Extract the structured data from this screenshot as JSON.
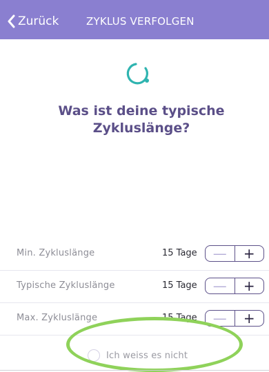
{
  "header": {
    "back_label": "Zurück",
    "title": "ZYKLUS VERFOLGEN",
    "background": "#8a7fd0"
  },
  "progress_icon": {
    "icon": "circular-spinner-icon",
    "color": "#2fb4b0"
  },
  "question": {
    "line1": "Was ist deine typische",
    "line2": "Zykluslänge?"
  },
  "settings": {
    "rows": [
      {
        "label": "Min. Zykluslänge",
        "value": "15 Tage",
        "minus": "—",
        "plus": "+"
      },
      {
        "label": "Typische Zykluslänge",
        "value": "15 Tage",
        "minus": "—",
        "plus": "+"
      },
      {
        "label": "Max. Zykluslänge",
        "value": "15 Tage",
        "minus": "—",
        "plus": "+"
      }
    ]
  },
  "dont_know": {
    "label": "Ich weiss es nicht",
    "checked": false
  },
  "accent_colors": {
    "heading": "#5b4f88",
    "highlight": "#8fd25a"
  }
}
